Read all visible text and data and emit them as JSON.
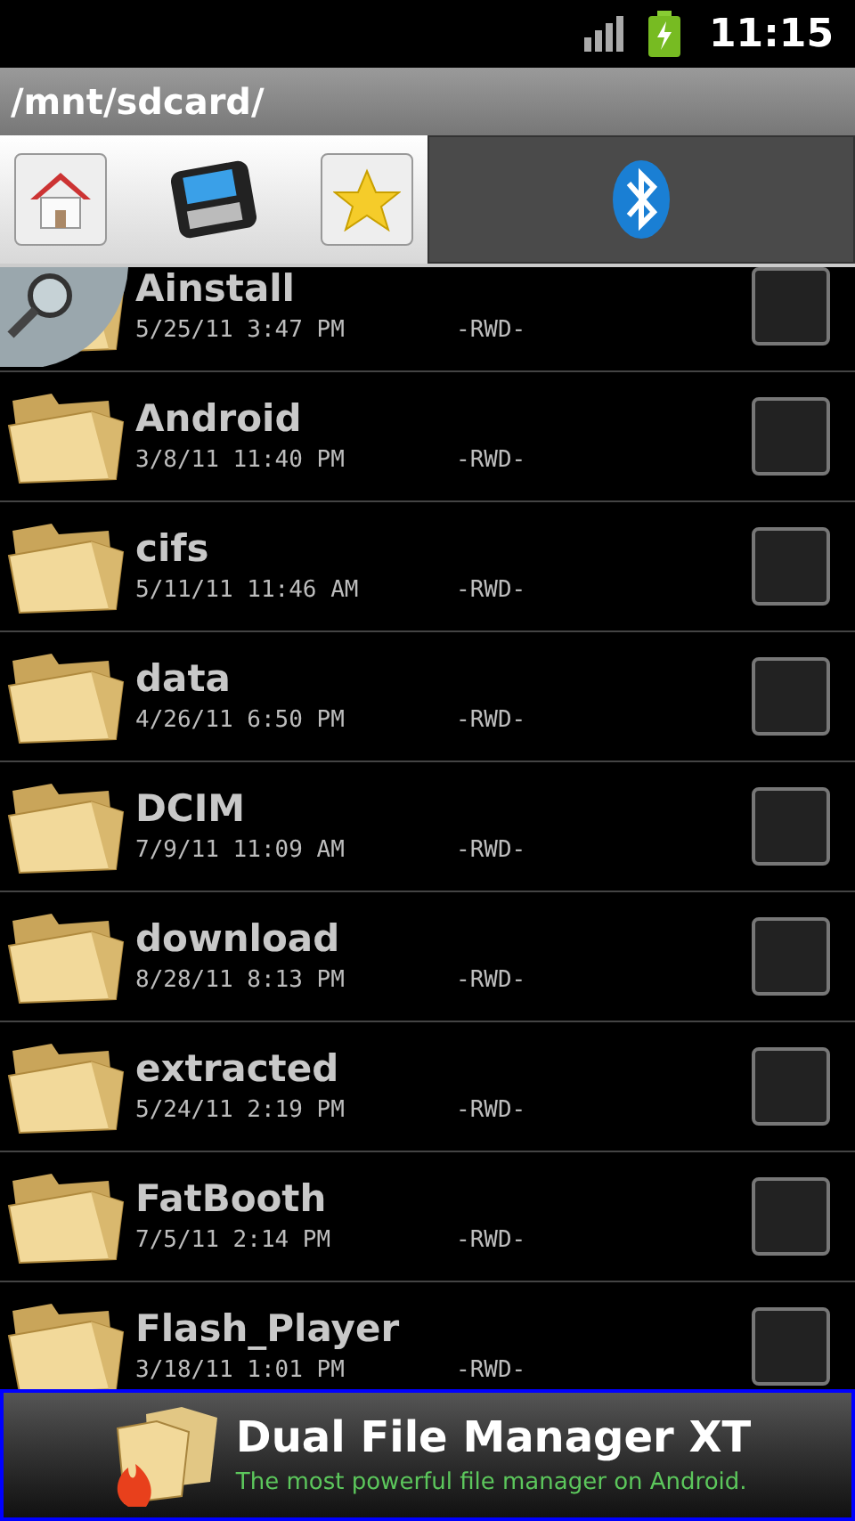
{
  "status_bar": {
    "time": "11:15"
  },
  "path": "/mnt/sdcard/",
  "panels": [
    {
      "kind": "local",
      "selected": true
    },
    {
      "kind": "bluetooth",
      "selected": false
    }
  ],
  "rows": [
    {
      "name": "Ainstall",
      "date": "5/25/11 3:47 PM",
      "permissions": "-RWD-",
      "checked": false
    },
    {
      "name": "Android",
      "date": "3/8/11 11:40 PM",
      "permissions": "-RWD-",
      "checked": false
    },
    {
      "name": "cifs",
      "date": "5/11/11 11:46 AM",
      "permissions": "-RWD-",
      "checked": false
    },
    {
      "name": "data",
      "date": "4/26/11 6:50 PM",
      "permissions": "-RWD-",
      "checked": false
    },
    {
      "name": "DCIM",
      "date": "7/9/11 11:09 AM",
      "permissions": "-RWD-",
      "checked": false
    },
    {
      "name": "download",
      "date": "8/28/11 8:13 PM",
      "permissions": "-RWD-",
      "checked": false
    },
    {
      "name": "extracted",
      "date": "5/24/11 2:19 PM",
      "permissions": "-RWD-",
      "checked": false
    },
    {
      "name": "FatBooth",
      "date": "7/5/11 2:14 PM",
      "permissions": "-RWD-",
      "checked": false
    },
    {
      "name": "Flash_Player",
      "date": "3/18/11 1:01 PM",
      "permissions": "-RWD-",
      "checked": false
    }
  ],
  "banner": {
    "title": "Dual File Manager XT",
    "subtitle": "The most powerful file manager on Android."
  }
}
